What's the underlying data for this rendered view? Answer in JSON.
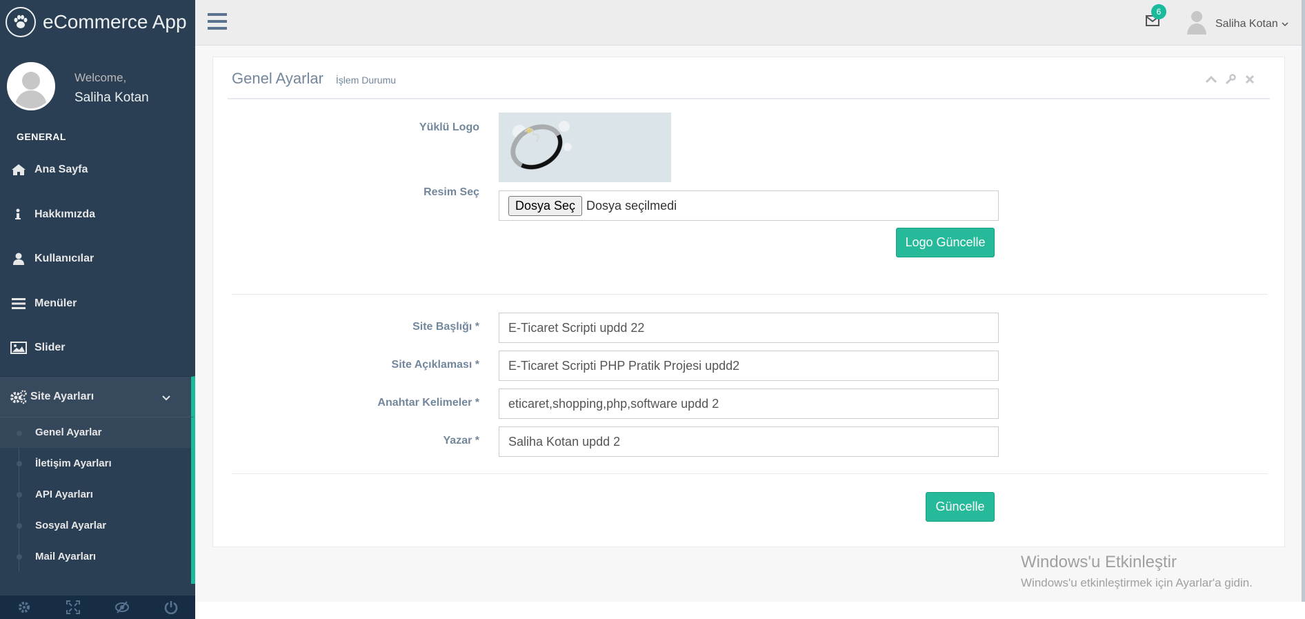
{
  "app": {
    "title": "eCommerce App"
  },
  "profile": {
    "welcome": "Welcome,",
    "name": "Saliha Kotan"
  },
  "sidebar": {
    "section": "GENERAL",
    "items": [
      {
        "label": "Ana Sayfa",
        "icon": "home-icon"
      },
      {
        "label": "Hakkımızda",
        "icon": "info-icon"
      },
      {
        "label": "Kullanıcılar",
        "icon": "user-icon"
      },
      {
        "label": "Menüler",
        "icon": "bars-icon"
      },
      {
        "label": "Slider",
        "icon": "image-icon"
      }
    ],
    "active": {
      "label": "Site Ayarları",
      "icon": "gears-icon"
    },
    "subitems": [
      "Genel Ayarlar",
      "İletişim Ayarları",
      "API Ayarları",
      "Sosyal Ayarlar",
      "Mail Ayarları"
    ],
    "footer_icons": [
      "settings-icon",
      "fullscreen-icon",
      "lock-icon",
      "logout-icon"
    ]
  },
  "topnav": {
    "mail_count": "6",
    "user_name": "Saliha Kotan"
  },
  "panel": {
    "title": "Genel Ayarlar",
    "subtitle": "İşlem Durumu",
    "logo": {
      "label": "Yüklü Logo",
      "file_label": "Resim Seç",
      "file_button": "Dosya Seç",
      "file_status": "Dosya seçilmedi",
      "submit": "Logo Güncelle"
    },
    "fields": [
      {
        "label": "Site Başlığı *",
        "value": "E-Ticaret Scripti updd 22"
      },
      {
        "label": "Site Açıklaması *",
        "value": "E-Ticaret Scripti PHP Pratik Projesi updd2"
      },
      {
        "label": "Anahtar Kelimeler *",
        "value": "eticaret,shopping,php,software updd 2"
      },
      {
        "label": "Yazar *",
        "value": "Saliha Kotan updd 2"
      }
    ],
    "submit": "Güncelle"
  },
  "watermark": {
    "title": "Windows'u Etkinleştir",
    "subtitle": "Windows'u etkinleştirmek için Ayarlar'a gidin."
  },
  "colors": {
    "sidebar": "#2a3f54",
    "accent": "#1abb9c",
    "button": "#26b99a"
  }
}
